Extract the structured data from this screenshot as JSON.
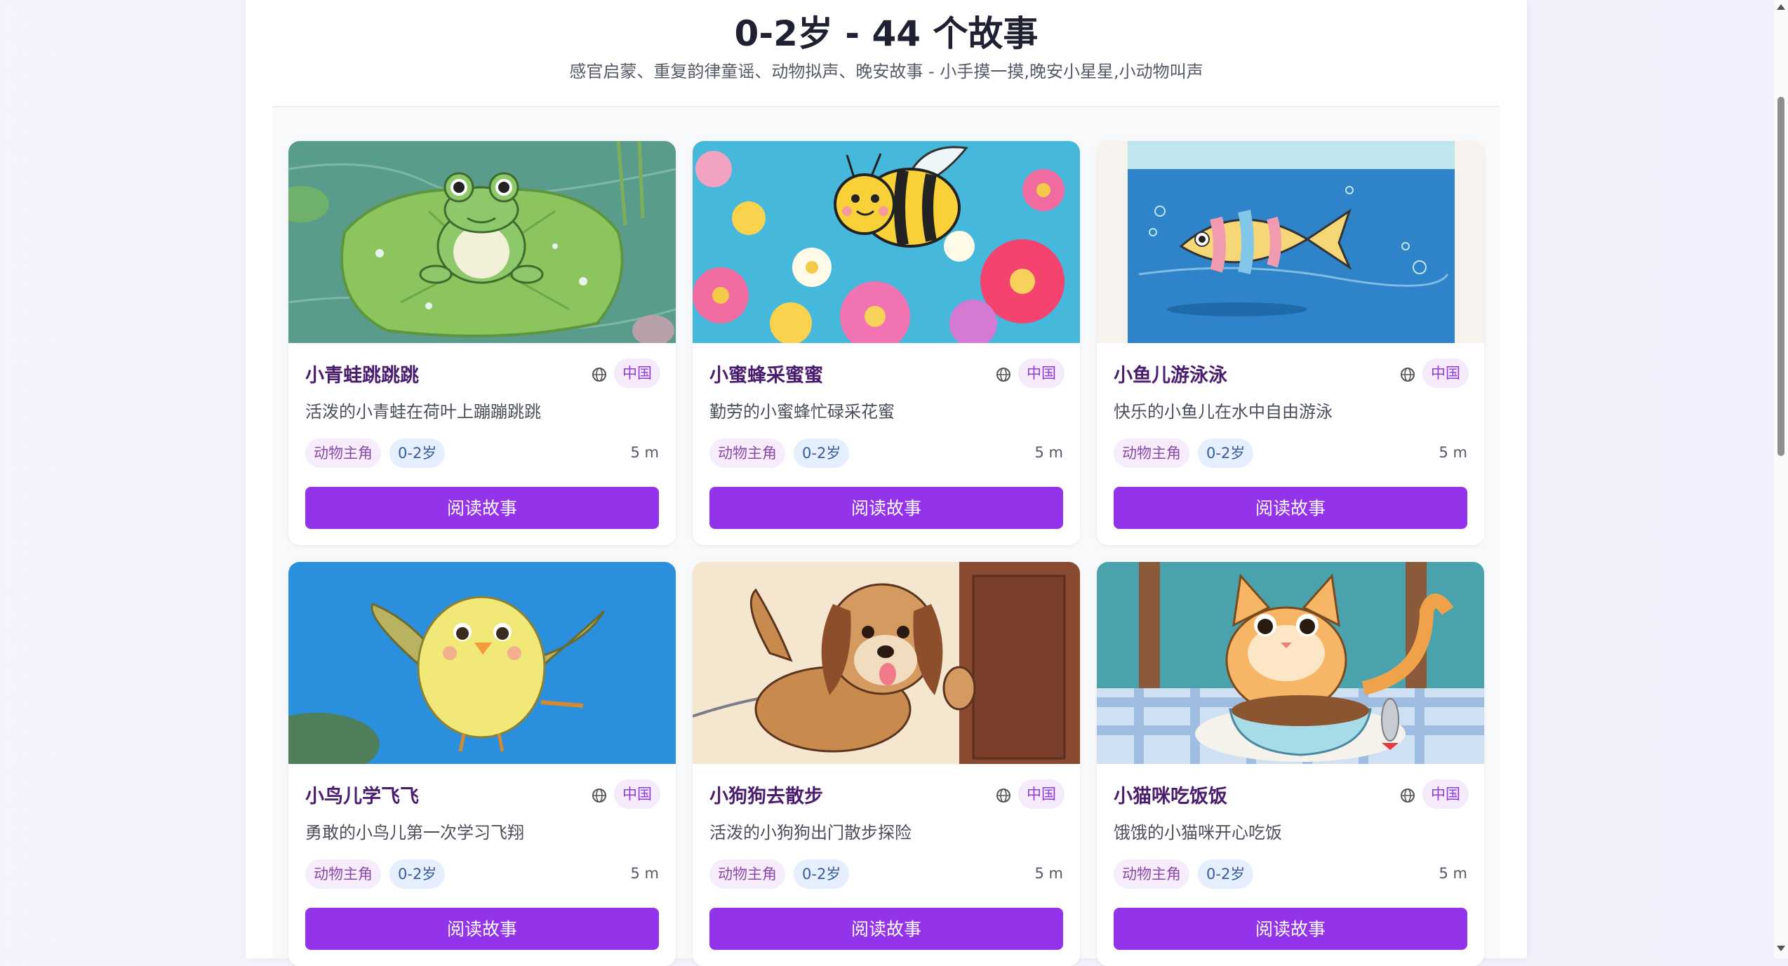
{
  "header": {
    "title": "0-2岁 - 44 个故事",
    "subtitle": "感官启蒙、重复韵律童谣、动物拟声、晚安故事 - 小手摸一摸,晚安小星星,小动物叫声"
  },
  "colors": {
    "accent": "#9333ea",
    "title_purple": "#4a1d6e",
    "badge_bg": "#f5e9fc",
    "age_tag_bg": "#e5efff"
  },
  "stories": [
    {
      "title": "小青蛙跳跳跳",
      "region": "中国",
      "description": "活泼的小青蛙在荷叶上蹦蹦跳跳",
      "theme_tag": "动物主角",
      "age_tag": "0-2岁",
      "duration": "5 m",
      "button": "阅读故事",
      "image": "frog-on-lilypad"
    },
    {
      "title": "小蜜蜂采蜜蜜",
      "region": "中国",
      "description": "勤劳的小蜜蜂忙碌采花蜜",
      "theme_tag": "动物主角",
      "age_tag": "0-2岁",
      "duration": "5 m",
      "button": "阅读故事",
      "image": "bee-in-flowers"
    },
    {
      "title": "小鱼儿游泳泳",
      "region": "中国",
      "description": "快乐的小鱼儿在水中自由游泳",
      "theme_tag": "动物主角",
      "age_tag": "0-2岁",
      "duration": "5 m",
      "button": "阅读故事",
      "image": "fish-swimming"
    },
    {
      "title": "小鸟儿学飞飞",
      "region": "中国",
      "description": "勇敢的小鸟儿第一次学习飞翔",
      "theme_tag": "动物主角",
      "age_tag": "0-2岁",
      "duration": "5 m",
      "button": "阅读故事",
      "image": "chick-flying"
    },
    {
      "title": "小狗狗去散步",
      "region": "中国",
      "description": "活泼的小狗狗出门散步探险",
      "theme_tag": "动物主角",
      "age_tag": "0-2岁",
      "duration": "5 m",
      "button": "阅读故事",
      "image": "puppy-walking"
    },
    {
      "title": "小猫咪吃饭饭",
      "region": "中国",
      "description": "饿饿的小猫咪开心吃饭",
      "theme_tag": "动物主角",
      "age_tag": "0-2岁",
      "duration": "5 m",
      "button": "阅读故事",
      "image": "kitten-eating"
    }
  ]
}
